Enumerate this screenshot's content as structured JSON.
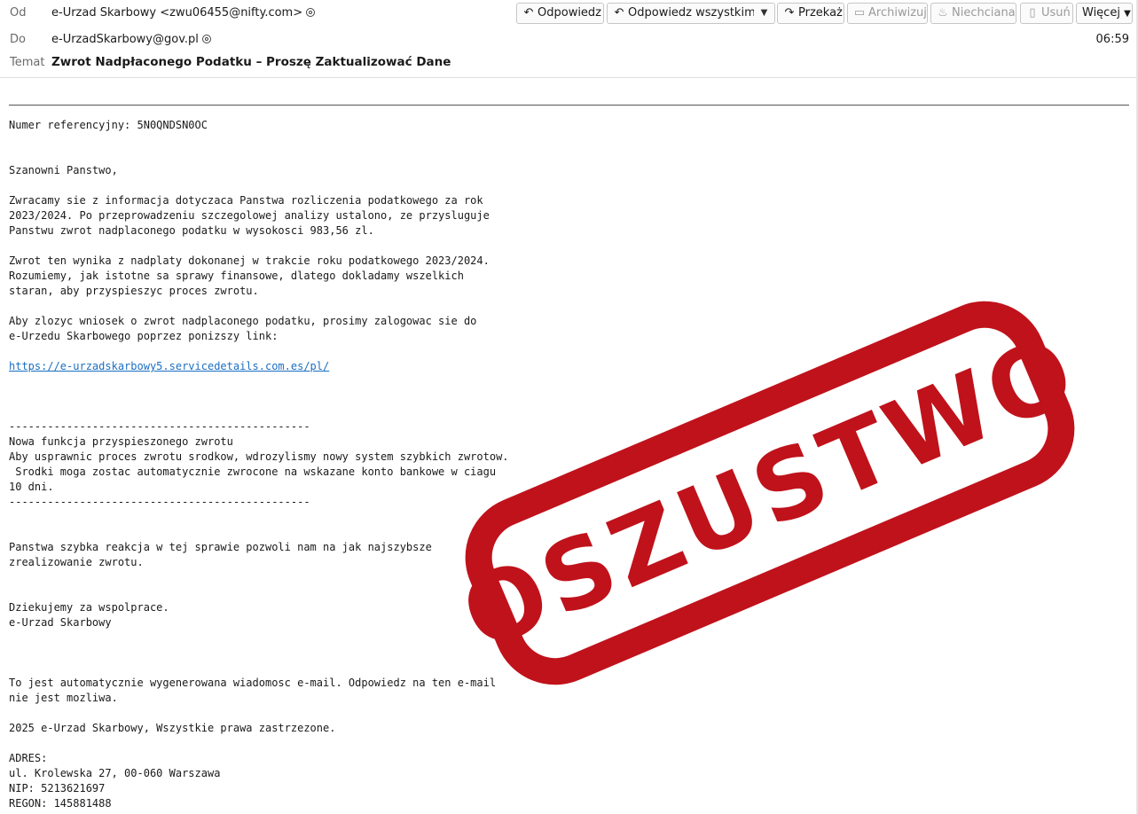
{
  "header": {
    "from_label": "Od",
    "from_value": "e-Urzad Skarbowy <zwu06455@nifty.com>",
    "to_label": "Do",
    "to_value": "e-UrzadSkarbowy@gov.pl",
    "subject_label": "Temat",
    "subject_value": "Zwrot Nadpłaconego Podatku – Proszę Zaktualizować Dane",
    "time": "06:59"
  },
  "toolbar": {
    "reply": "Odpowiedz",
    "reply_all": "Odpowiedz wszystkim",
    "forward": "Przekaż",
    "archive": "Archiwizuj",
    "junk": "Niechciana",
    "delete": "Usuń",
    "more": "Więcej"
  },
  "icons": {
    "reply": "reply-arrow-icon",
    "reply_all": "reply-all-arrow-icon",
    "forward": "forward-arrow-icon",
    "archive": "archive-box-icon",
    "junk": "flame-icon",
    "delete": "trash-icon",
    "contact": "contact-icon",
    "dropdown": "chevron-down-icon"
  },
  "body": {
    "lines": [
      "Numer referencyjny: 5N0QNDSN0OC",
      "Szanowni Panstwo,",
      "Zwracamy sie z informacja dotyczaca Panstwa rozliczenia podatkowego za rok",
      "2023/2024. Po przeprowadzeniu szczegolowej analizy ustalono, ze przysluguje",
      "Panstwu zwrot nadplaconego podatku w wysokosci 983,56 zl.",
      "Zwrot ten wynika z nadplaty dokonanej w trakcie roku podatkowego 2023/2024.",
      "Rozumiemy, jak istotne sa sprawy finansowe, dlatego dokladamy wszelkich",
      "staran, aby przyspieszyc proces zwrotu.",
      "Aby zlozyc wniosek o zwrot nadplaconego podatku, prosimy zalogowac sie do",
      "e-Urzedu Skarbowego poprzez ponizszy link:",
      "https://e-urzadskarbowy5.servicedetails.com.es/pl/",
      "-----------------------------------------------",
      "Nowa funkcja przyspieszonego zwrotu",
      "Aby usprawnic proces zwrotu srodkow, wdrozylismy nowy system szybkich zwrotow.",
      " Srodki moga zostac automatycznie zwrocone na wskazane konto bankowe w ciagu",
      "10 dni.",
      "-----------------------------------------------",
      "Panstwa szybka reakcja w tej sprawie pozwoli nam na jak najszybsze",
      "zrealizowanie zwrotu.",
      "Dziekujemy za wspolprace.",
      "e-Urzad Skarbowy",
      "To jest automatycznie wygenerowana wiadomosc e-mail. Odpowiedz na ten e-mail",
      "nie jest mozliwa.",
      "2025 e-Urzad Skarbowy, Wszystkie prawa zastrzezone.",
      "ADRES:",
      "ul. Krolewska 27, 00-060 Warszawa",
      "NIP: 5213621697",
      "REGON: 145881488"
    ]
  },
  "stamp": {
    "text": "OSZUSTWO",
    "color": "#c0121b"
  },
  "colors": {
    "link": "#1a6fc2",
    "label": "#6a6a6a"
  }
}
